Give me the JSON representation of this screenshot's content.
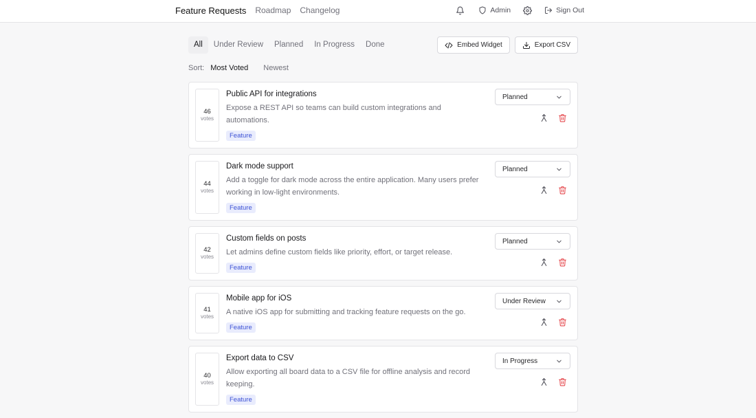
{
  "nav": {
    "brand": "Feature Requests",
    "links": [
      "Roadmap",
      "Changelog"
    ],
    "admin": {
      "label": "Admin",
      "icon": "shield-icon"
    },
    "settings_icon": "gear-icon",
    "notifications_icon": "bell-icon",
    "signout": {
      "label": "Sign Out",
      "icon": "sign-out-icon"
    }
  },
  "filters": {
    "tabs": [
      "All",
      "Under Review",
      "Planned",
      "In Progress",
      "Done"
    ],
    "active_tab": "All"
  },
  "actions": {
    "embed": {
      "label": "Embed Widget",
      "icon": "code-icon"
    },
    "export": {
      "label": "Export CSV",
      "icon": "download-icon"
    }
  },
  "sort": {
    "label": "Sort:",
    "options": [
      "Most Voted",
      "Newest"
    ],
    "active": "Most Voted"
  },
  "posts": [
    {
      "votes": "46",
      "votes_label": "votes",
      "title": "Public API for integrations",
      "description": "Expose a REST API so teams can build custom integrations and automations.",
      "tag": "Feature",
      "status": "Planned"
    },
    {
      "votes": "44",
      "votes_label": "votes",
      "title": "Dark mode support",
      "description": "Add a toggle for dark mode across the entire application. Many users prefer working in low-light environments.",
      "tag": "Feature",
      "status": "Planned"
    },
    {
      "votes": "42",
      "votes_label": "votes",
      "title": "Custom fields on posts",
      "description": "Let admins define custom fields like priority, effort, or target release.",
      "tag": "Feature",
      "status": "Planned"
    },
    {
      "votes": "41",
      "votes_label": "votes",
      "title": "Mobile app for iOS",
      "description": "A native iOS app for submitting and tracking feature requests on the go.",
      "tag": "Feature",
      "status": "Under Review"
    },
    {
      "votes": "40",
      "votes_label": "votes",
      "title": "Export data to CSV",
      "description": "Allow exporting all board data to a CSV file for offline analysis and record keeping.",
      "tag": "Feature",
      "status": "In Progress"
    }
  ],
  "colors": {
    "tag_text": "#3d52d5",
    "tag_bg": "#e9ecfd",
    "delete": "#e5484d"
  }
}
